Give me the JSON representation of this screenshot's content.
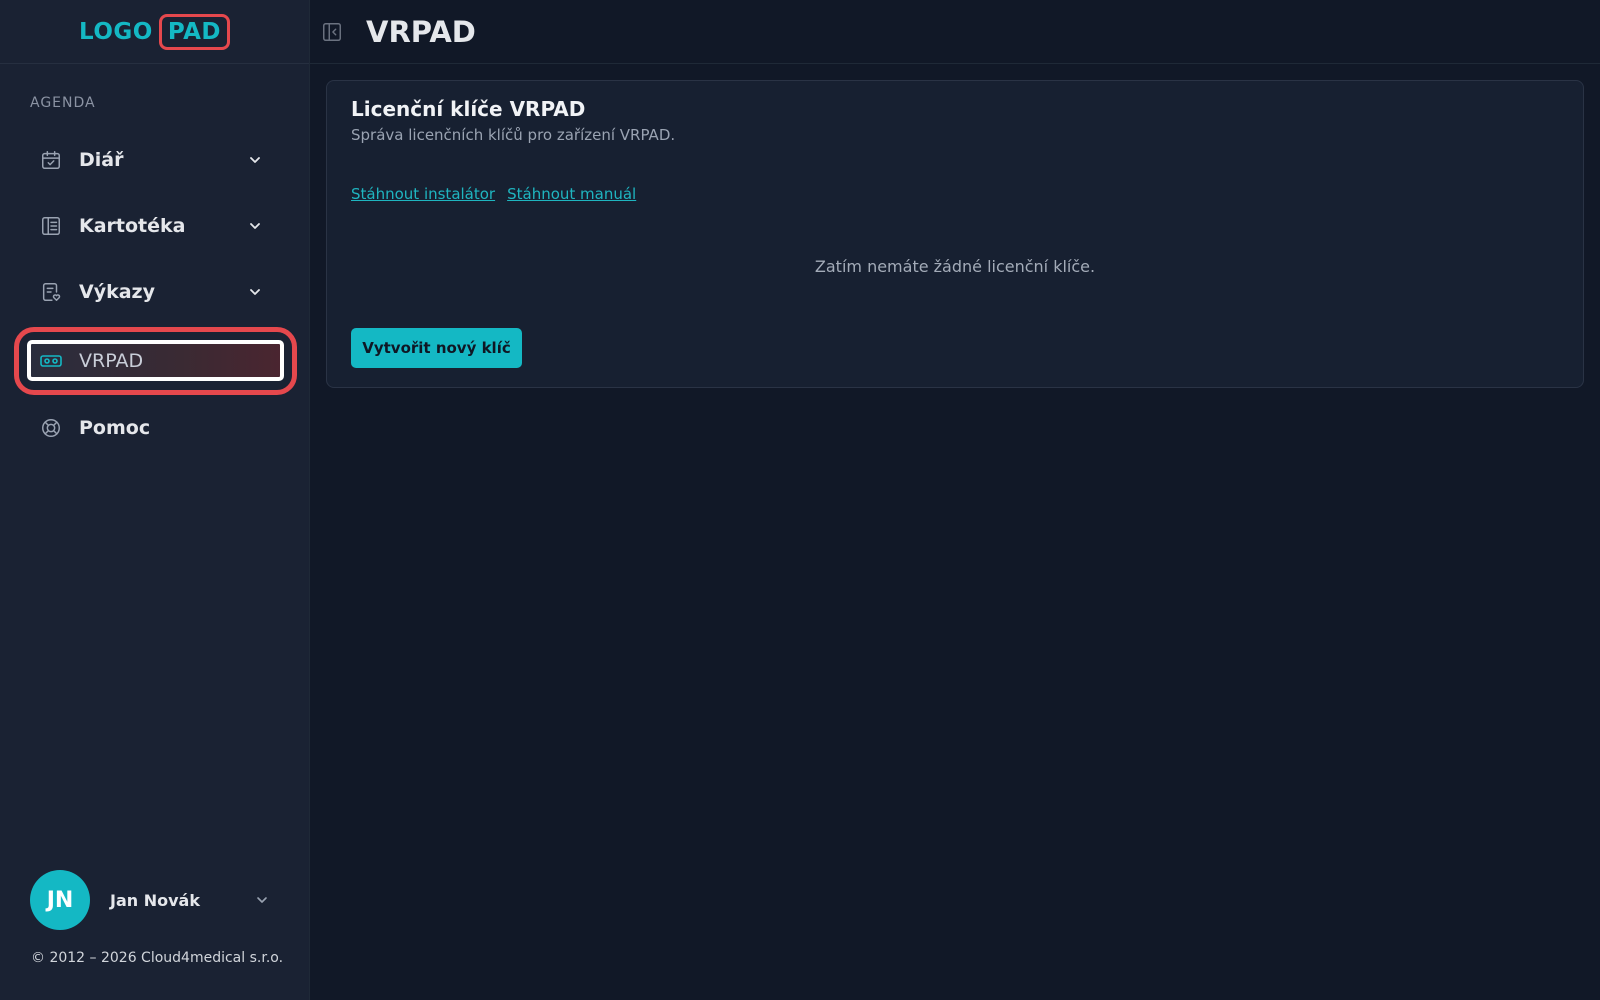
{
  "brand": {
    "logo_text": "LOGO",
    "logo_highlight": "PAD"
  },
  "sidebar": {
    "section_label": "AGENDA",
    "items": [
      {
        "label": "Diář",
        "icon": "calendar-check-icon",
        "expandable": true
      },
      {
        "label": "Kartotéka",
        "icon": "card-file-icon",
        "expandable": true
      },
      {
        "label": "Výkazy",
        "icon": "report-heart-icon",
        "expandable": true
      },
      {
        "label": "VRPAD",
        "icon": "vr-headset-icon",
        "expandable": false,
        "active": true
      },
      {
        "label": "Pomoc",
        "icon": "lifebuoy-icon",
        "expandable": false
      }
    ]
  },
  "user": {
    "initials": "JN",
    "name": "Jan Novák"
  },
  "footer": {
    "copyright": "© 2012 – 2026 Cloud4medical s.r.o."
  },
  "header": {
    "title": "VRPAD"
  },
  "card": {
    "title": "Licenční klíče VRPAD",
    "subtitle": "Správa licenčních klíčů pro zařízení VRPAD.",
    "links": [
      "Stáhnout instalátor",
      "Stáhnout manuál"
    ],
    "empty_message": "Zatím nemáte žádné licenční klíče.",
    "create_button": "Vytvořit nový klíč"
  },
  "colors": {
    "accent": "#14b8c4",
    "highlight_border": "#e5484d",
    "background": "#111827",
    "sidebar_bg": "#1a2233"
  }
}
